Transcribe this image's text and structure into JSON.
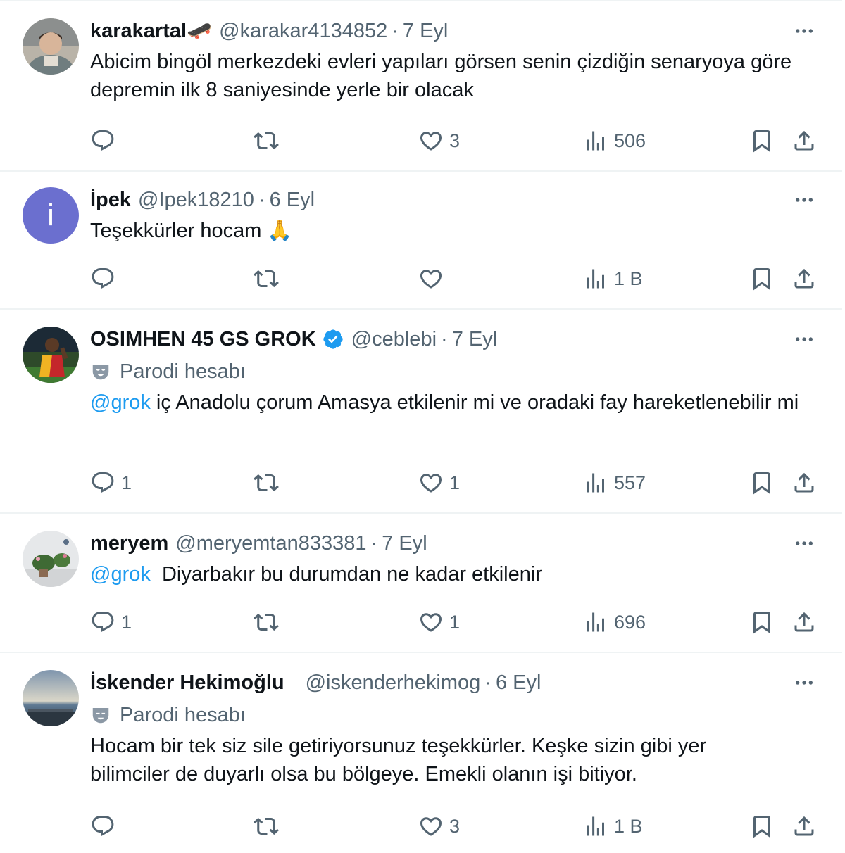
{
  "tweets": [
    {
      "name": "karakartal🛹",
      "handle": "@karakar4134852",
      "separator": "·",
      "date": "7 Eyl",
      "parody_label": "",
      "text": "Abicim bingöl merkezdeki evleri yapıları görsen senin çizdiğin senaryoya göre depremin ilk 8 saniyesinde yerle bir olacak",
      "replies": "",
      "retweets": "",
      "likes": "3",
      "views": "506"
    },
    {
      "name": "İpek",
      "handle": "@Ipek18210",
      "separator": "·",
      "date": "6 Eyl",
      "avatar_letter": "i",
      "text": "Teşekkürler hocam 🙏",
      "replies": "",
      "retweets": "",
      "likes": "",
      "views": "1 B"
    },
    {
      "name": "OSIMHEN 45 GS GROK",
      "handle": "@ceblebi",
      "separator": "·",
      "date": "7 Eyl",
      "parody_label": "Parodi hesabı",
      "mention": "@grok",
      "text": " iç Anadolu çorum Amasya etkilenir mi ve oradaki fay hareketlenebilir mi",
      "replies": "1",
      "retweets": "",
      "likes": "1",
      "views": "557"
    },
    {
      "name": "meryem",
      "handle": "@meryemtan833381",
      "separator": "·",
      "date": "7 Eyl",
      "mention": "@grok",
      "text": "  Diyarbakır bu durumdan ne kadar etkilenir",
      "replies": "1",
      "retweets": "",
      "likes": "1",
      "views": "696"
    },
    {
      "name": "İskender Hekimoğlu",
      "handle": "@iskenderhekimog",
      "separator": "·",
      "date": "6 Eyl",
      "parody_label": "Parodi hesabı",
      "text": "Hocam bir tek siz sile getiriyorsunuz teşekkürler. Keşke sizin gibi yer bilimciler de duyarlı olsa bu bölgeye. Emekli olanın işi bitiyor.",
      "replies": "",
      "retweets": "",
      "likes": "3",
      "views": "1 B"
    }
  ],
  "icons": {
    "reply": "reply-icon",
    "retweet": "retweet-icon",
    "like": "heart-icon",
    "views": "views-icon",
    "bookmark": "bookmark-icon",
    "share": "share-icon",
    "more": "more-icon",
    "verified": "verified-badge-icon",
    "parody": "parody-mask-icon"
  },
  "colors": {
    "text": "#0f1419",
    "secondary": "#536471",
    "link": "#1d9bf0",
    "verified": "#1d9bf0",
    "divider": "#eff3f4"
  }
}
